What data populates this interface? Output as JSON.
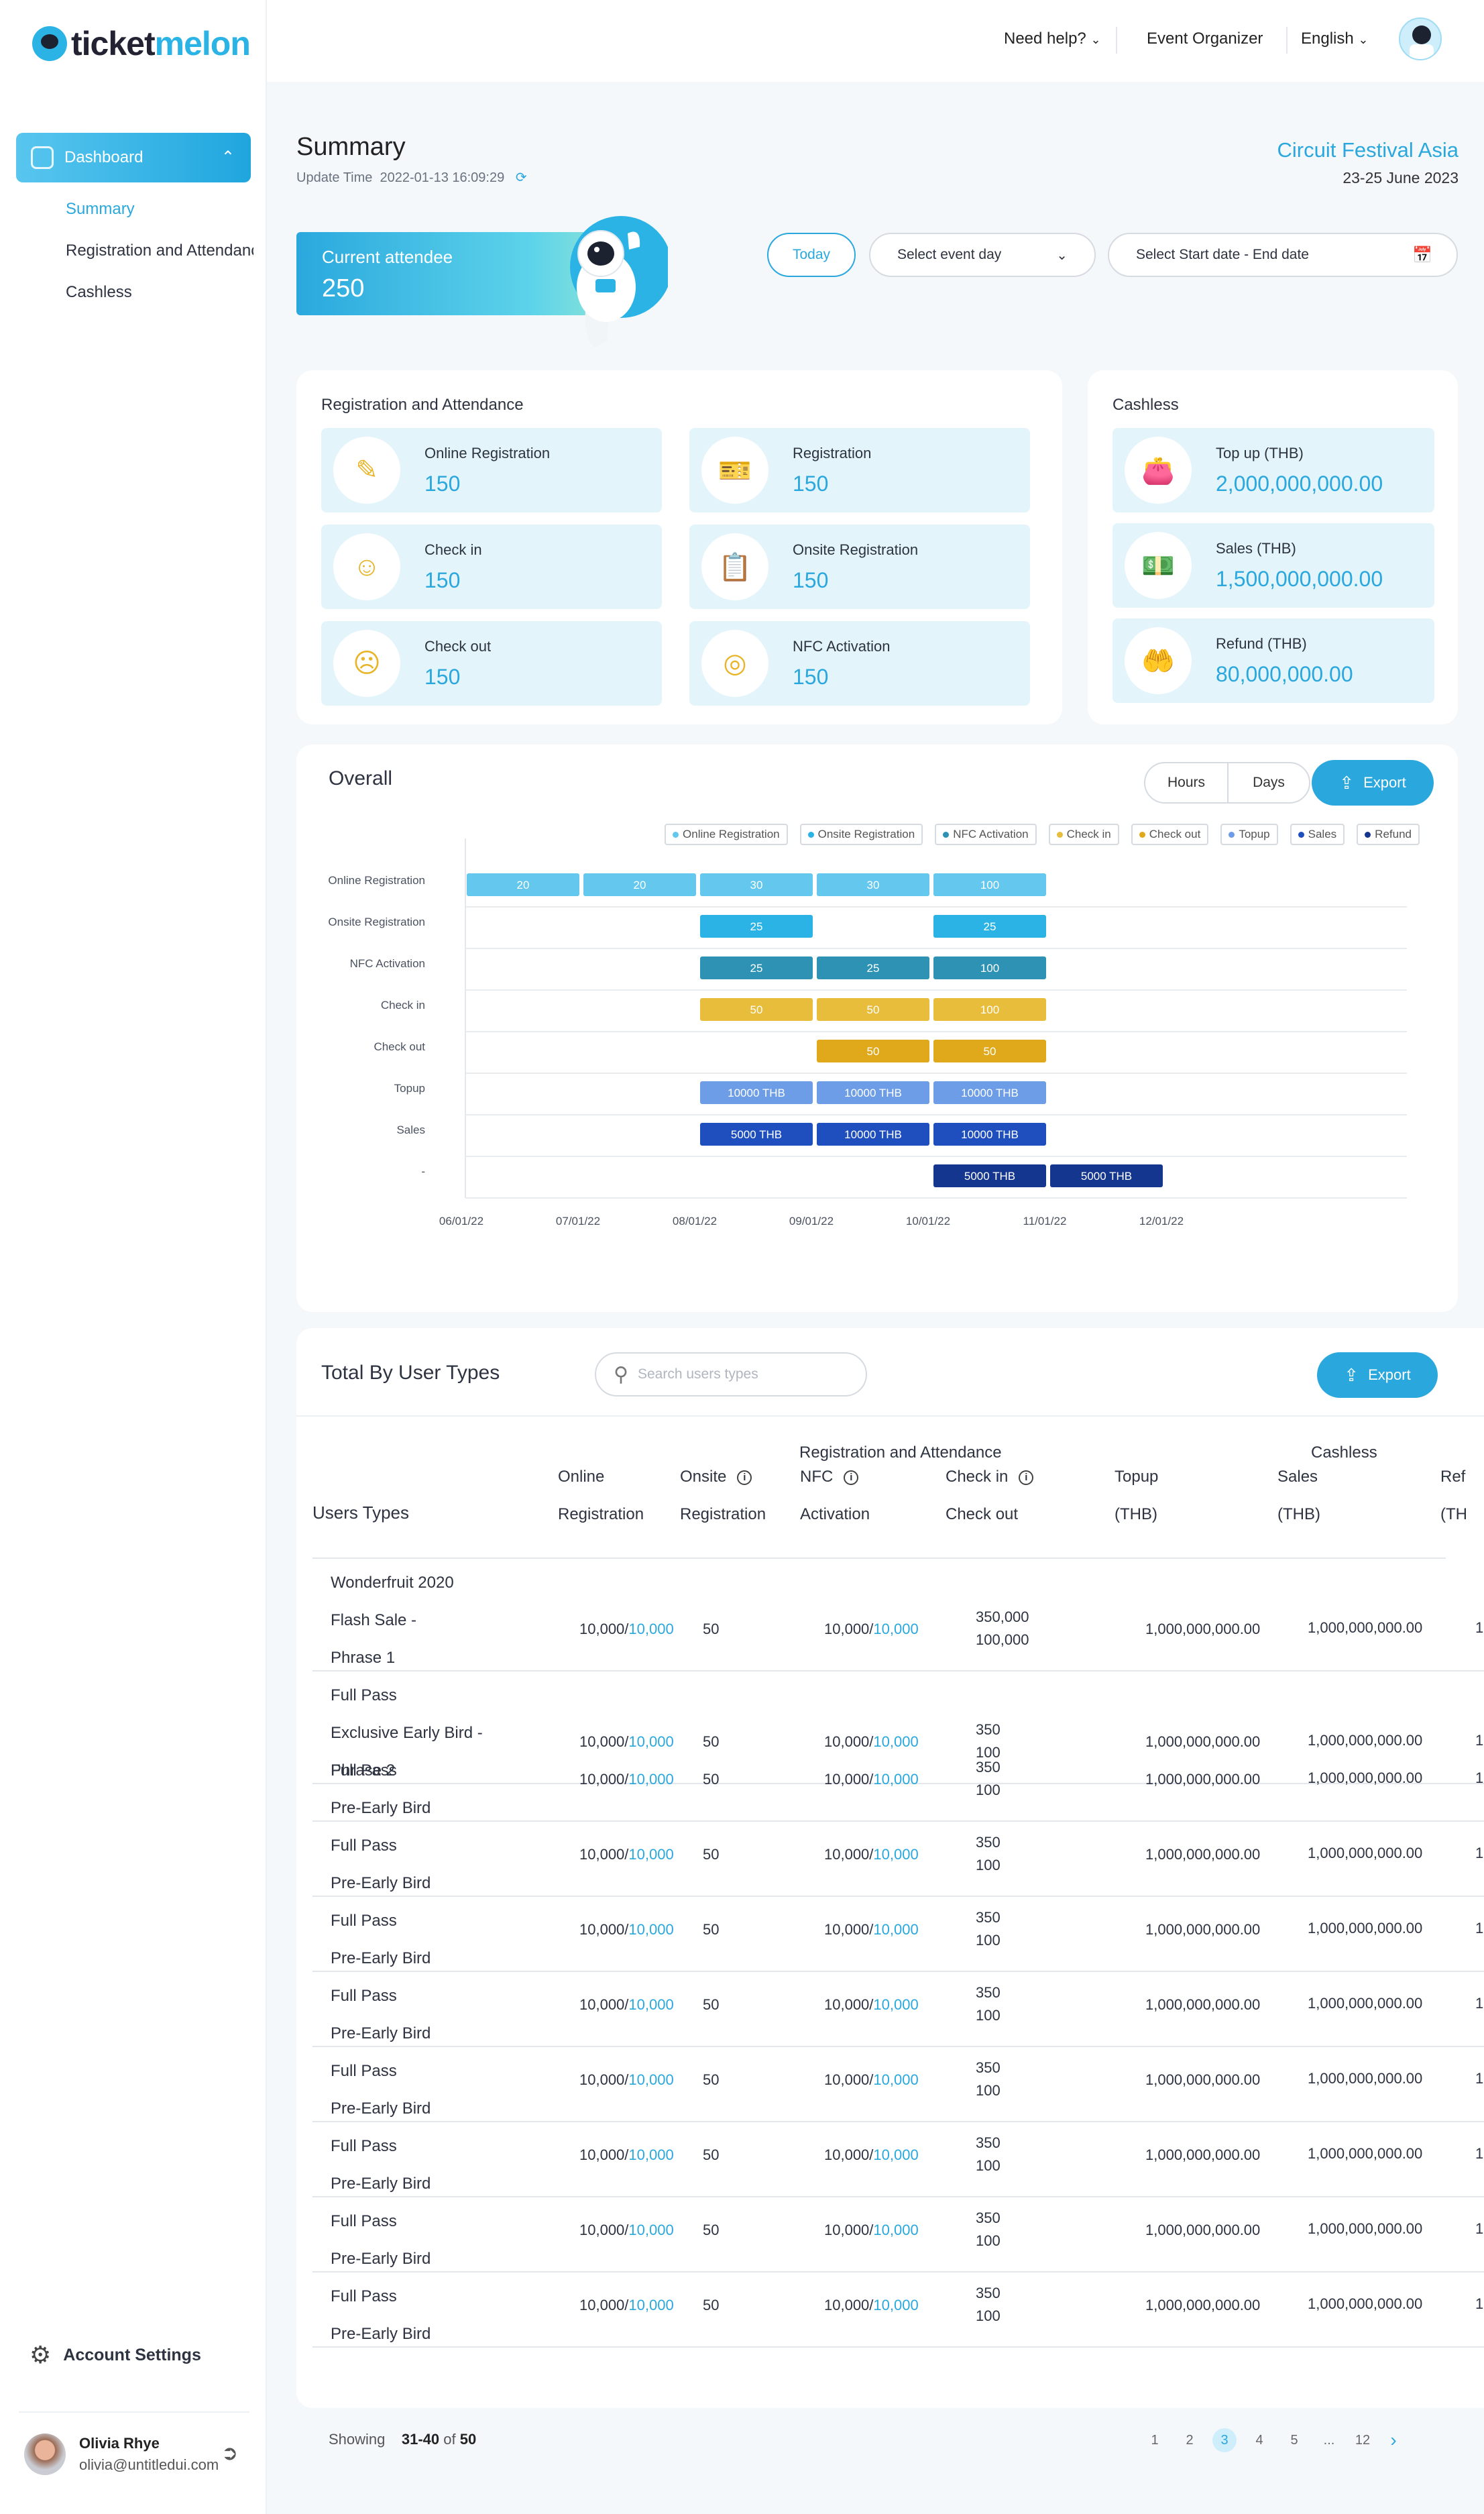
{
  "app": {
    "logo_text_a": "ticket",
    "logo_text_b": "melon"
  },
  "sidebar": {
    "dashboard_label": "Dashboard",
    "items": [
      {
        "label": "Summary",
        "active": true
      },
      {
        "label": "Registration and Attendance",
        "active": false
      },
      {
        "label": "Cashless",
        "active": false
      }
    ],
    "account_settings": "Account  Settings",
    "user": {
      "name": "Olivia Rhye",
      "email": "olivia@untitledui.com"
    }
  },
  "topbar": {
    "help": "Need help?",
    "organizer": "Event Organizer",
    "language": "English"
  },
  "page": {
    "title": "Summary",
    "update_label": "Update Time",
    "update_time": "2022-01-13  16:09:29",
    "event_name": "Circuit Festival Asia",
    "event_dates": "23-25 June 2023"
  },
  "attendee": {
    "label": "Current attendee",
    "value": "250"
  },
  "filters": {
    "today": "Today",
    "event_day": "Select event day",
    "date_range": "Select Start date - End date"
  },
  "registration_card": {
    "title": "Registration and Attendance",
    "stats": [
      {
        "label": "Online Registration",
        "value": "150",
        "icon": "edit-icon"
      },
      {
        "label": "Registration",
        "value": "150",
        "icon": "ticket-icon"
      },
      {
        "label": "Check in",
        "value": "150",
        "icon": "user-plus-icon"
      },
      {
        "label": "Onsite Registration",
        "value": "150",
        "icon": "clipboard-icon"
      },
      {
        "label": "Check out",
        "value": "150",
        "icon": "user-minus-icon"
      },
      {
        "label": "NFC Activation",
        "value": "150",
        "icon": "nfc-icon"
      }
    ]
  },
  "cashless_card": {
    "title": "Cashless",
    "stats": [
      {
        "label": "Top up (THB)",
        "value": "2,000,000,000.00",
        "icon": "wallet-icon"
      },
      {
        "label": "Sales (THB)",
        "value": "1,500,000,000.00",
        "icon": "cash-icon"
      },
      {
        "label": "Refund (THB)",
        "value": "80,000,000.00",
        "icon": "refund-icon"
      }
    ]
  },
  "overall": {
    "title": "Overall",
    "hours": "Hours",
    "days": "Days",
    "export": "Export"
  },
  "colors": {
    "accent": "#2aa8de",
    "online": "#63c7ee",
    "onsite": "#2bb3e6",
    "nfc": "#2d92b3",
    "checkin": "#e8bd3c",
    "checkout": "#e0a91b",
    "topup": "#6c9de6",
    "sales": "#1f4fbf",
    "refund": "#15368f"
  },
  "chart_data": {
    "type": "bar",
    "orientation": "horizontal-timeline",
    "categories": [
      "Online Registration",
      "Onsite Registration",
      "NFC Activation",
      "Check in",
      "Check out",
      "Topup",
      "Sales",
      "-"
    ],
    "x_ticks": [
      "06/01/22",
      "07/01/22",
      "08/01/22",
      "09/01/22",
      "10/01/22",
      "11/01/22",
      "12/01/22"
    ],
    "legend": [
      "Online Registration",
      "Onsite Registration",
      "NFC Activation",
      "Check in",
      "Check out",
      "Topup",
      "Sales",
      "Refund"
    ],
    "legend_colors": [
      "#63c7ee",
      "#2bb3e6",
      "#2d92b3",
      "#e8bd3c",
      "#e0a91b",
      "#6c9de6",
      "#1f4fbf",
      "#15368f"
    ],
    "legend_position": "top-right",
    "grid": true,
    "bars": [
      {
        "row": 0,
        "start": 0,
        "label": "20",
        "color": "#63c7ee"
      },
      {
        "row": 0,
        "start": 1,
        "label": "20",
        "color": "#63c7ee"
      },
      {
        "row": 0,
        "start": 2,
        "label": "30",
        "color": "#63c7ee"
      },
      {
        "row": 0,
        "start": 3,
        "label": "30",
        "color": "#63c7ee"
      },
      {
        "row": 0,
        "start": 4,
        "label": "100",
        "color": "#63c7ee"
      },
      {
        "row": 1,
        "start": 2,
        "label": "25",
        "color": "#2bb3e6"
      },
      {
        "row": 1,
        "start": 4,
        "label": "25",
        "color": "#2bb3e6"
      },
      {
        "row": 2,
        "start": 2,
        "label": "25",
        "color": "#2d92b3"
      },
      {
        "row": 2,
        "start": 3,
        "label": "25",
        "color": "#2d92b3"
      },
      {
        "row": 2,
        "start": 4,
        "label": "100",
        "color": "#2d92b3"
      },
      {
        "row": 3,
        "start": 2,
        "label": "50",
        "color": "#e8bd3c"
      },
      {
        "row": 3,
        "start": 3,
        "label": "50",
        "color": "#e8bd3c"
      },
      {
        "row": 3,
        "start": 4,
        "label": "100",
        "color": "#e8bd3c"
      },
      {
        "row": 4,
        "start": 3,
        "label": "50",
        "color": "#e0a91b"
      },
      {
        "row": 4,
        "start": 4,
        "label": "50",
        "color": "#e0a91b"
      },
      {
        "row": 5,
        "start": 2,
        "label": "10000 THB",
        "color": "#6c9de6"
      },
      {
        "row": 5,
        "start": 3,
        "label": "10000 THB",
        "color": "#6c9de6"
      },
      {
        "row": 5,
        "start": 4,
        "label": "10000 THB",
        "color": "#6c9de6"
      },
      {
        "row": 6,
        "start": 2,
        "label": "5000 THB",
        "color": "#1f4fbf"
      },
      {
        "row": 6,
        "start": 3,
        "label": "10000 THB",
        "color": "#1f4fbf"
      },
      {
        "row": 6,
        "start": 4,
        "label": "10000 THB",
        "color": "#1f4fbf"
      },
      {
        "row": 7,
        "start": 4,
        "label": "5000 THB",
        "color": "#15368f"
      },
      {
        "row": 7,
        "start": 5,
        "label": "5000 THB",
        "color": "#15368f"
      }
    ]
  },
  "user_types": {
    "title": "Total By User Types",
    "search_placeholder": "Search users types",
    "export": "Export",
    "group_reg": "Registration and Attendance",
    "group_cash": "Cashless",
    "col_users": "Users Types",
    "columns": [
      {
        "l1": "Online",
        "l2": "Registration"
      },
      {
        "l1": "Onsite",
        "l2": "Registration"
      },
      {
        "l1": "NFC",
        "l2": "Activation"
      },
      {
        "l1": "Check in",
        "l2": "Check out"
      },
      {
        "l1": "Topup",
        "l2": "(THB)"
      },
      {
        "l1": "Sales",
        "l2": "(THB)"
      },
      {
        "l1": "Ref",
        "l2": "(TH"
      }
    ],
    "rows": [
      {
        "lines": [
          "Wonderfruit 2020",
          "Flash Sale -",
          "Phrase 1"
        ],
        "online_a": "10,000/",
        "online_b": "10,000",
        "onsite": "50",
        "nfc_a": "10,000/",
        "nfc_b": "10,000",
        "checkin": "350,000",
        "checkout": "100,000",
        "topup": "1,000,000,000.00",
        "sales": "1,000,000,000.00",
        "refund": "1"
      },
      {
        "lines": [
          "Full Pass",
          "Exclusive Early Bird -",
          "Phrase 2"
        ],
        "online_a": "10,000/",
        "online_b": "10,000",
        "onsite": "50",
        "nfc_a": "10,000/",
        "nfc_b": "10,000",
        "checkin": "350",
        "checkout": "100",
        "topup": "1,000,000,000.00",
        "sales": "1,000,000,000.00",
        "refund": "1"
      },
      {
        "lines": [
          "Full Pass",
          "Pre-Early Bird"
        ],
        "online_a": "10,000/",
        "online_b": "10,000",
        "onsite": "50",
        "nfc_a": "10,000/",
        "nfc_b": "10,000",
        "checkin": "350",
        "checkout": "100",
        "topup": "1,000,000,000.00",
        "sales": "1,000,000,000.00",
        "refund": "1"
      },
      {
        "lines": [
          "Full Pass",
          "Pre-Early Bird"
        ],
        "online_a": "10,000/",
        "online_b": "10,000",
        "onsite": "50",
        "nfc_a": "10,000/",
        "nfc_b": "10,000",
        "checkin": "350",
        "checkout": "100",
        "topup": "1,000,000,000.00",
        "sales": "1,000,000,000.00",
        "refund": "1"
      },
      {
        "lines": [
          "Full Pass",
          "Pre-Early Bird"
        ],
        "online_a": "10,000/",
        "online_b": "10,000",
        "onsite": "50",
        "nfc_a": "10,000/",
        "nfc_b": "10,000",
        "checkin": "350",
        "checkout": "100",
        "topup": "1,000,000,000.00",
        "sales": "1,000,000,000.00",
        "refund": "1"
      },
      {
        "lines": [
          "Full Pass",
          "Pre-Early Bird"
        ],
        "online_a": "10,000/",
        "online_b": "10,000",
        "onsite": "50",
        "nfc_a": "10,000/",
        "nfc_b": "10,000",
        "checkin": "350",
        "checkout": "100",
        "topup": "1,000,000,000.00",
        "sales": "1,000,000,000.00",
        "refund": "1"
      },
      {
        "lines": [
          "Full Pass",
          "Pre-Early Bird"
        ],
        "online_a": "10,000/",
        "online_b": "10,000",
        "onsite": "50",
        "nfc_a": "10,000/",
        "nfc_b": "10,000",
        "checkin": "350",
        "checkout": "100",
        "topup": "1,000,000,000.00",
        "sales": "1,000,000,000.00",
        "refund": "1"
      },
      {
        "lines": [
          "Full Pass",
          "Pre-Early Bird"
        ],
        "online_a": "10,000/",
        "online_b": "10,000",
        "onsite": "50",
        "nfc_a": "10,000/",
        "nfc_b": "10,000",
        "checkin": "350",
        "checkout": "100",
        "topup": "1,000,000,000.00",
        "sales": "1,000,000,000.00",
        "refund": "1"
      },
      {
        "lines": [
          "Full Pass",
          "Pre-Early Bird"
        ],
        "online_a": "10,000/",
        "online_b": "10,000",
        "onsite": "50",
        "nfc_a": "10,000/",
        "nfc_b": "10,000",
        "checkin": "350",
        "checkout": "100",
        "topup": "1,000,000,000.00",
        "sales": "1,000,000,000.00",
        "refund": "1"
      },
      {
        "lines": [
          "Full Pass",
          "Pre-Early Bird"
        ],
        "online_a": "10,000/",
        "online_b": "10,000",
        "onsite": "50",
        "nfc_a": "10,000/",
        "nfc_b": "10,000",
        "checkin": "350",
        "checkout": "100",
        "topup": "1,000,000,000.00",
        "sales": "1,000,000,000.00",
        "refund": "1"
      }
    ]
  },
  "pagination": {
    "showing": "Showing",
    "range": "31-40",
    "of": "of",
    "total": "50",
    "pages": [
      "1",
      "2",
      "3",
      "4",
      "5",
      "...",
      "12"
    ],
    "current_index": 2,
    "next": "›"
  }
}
